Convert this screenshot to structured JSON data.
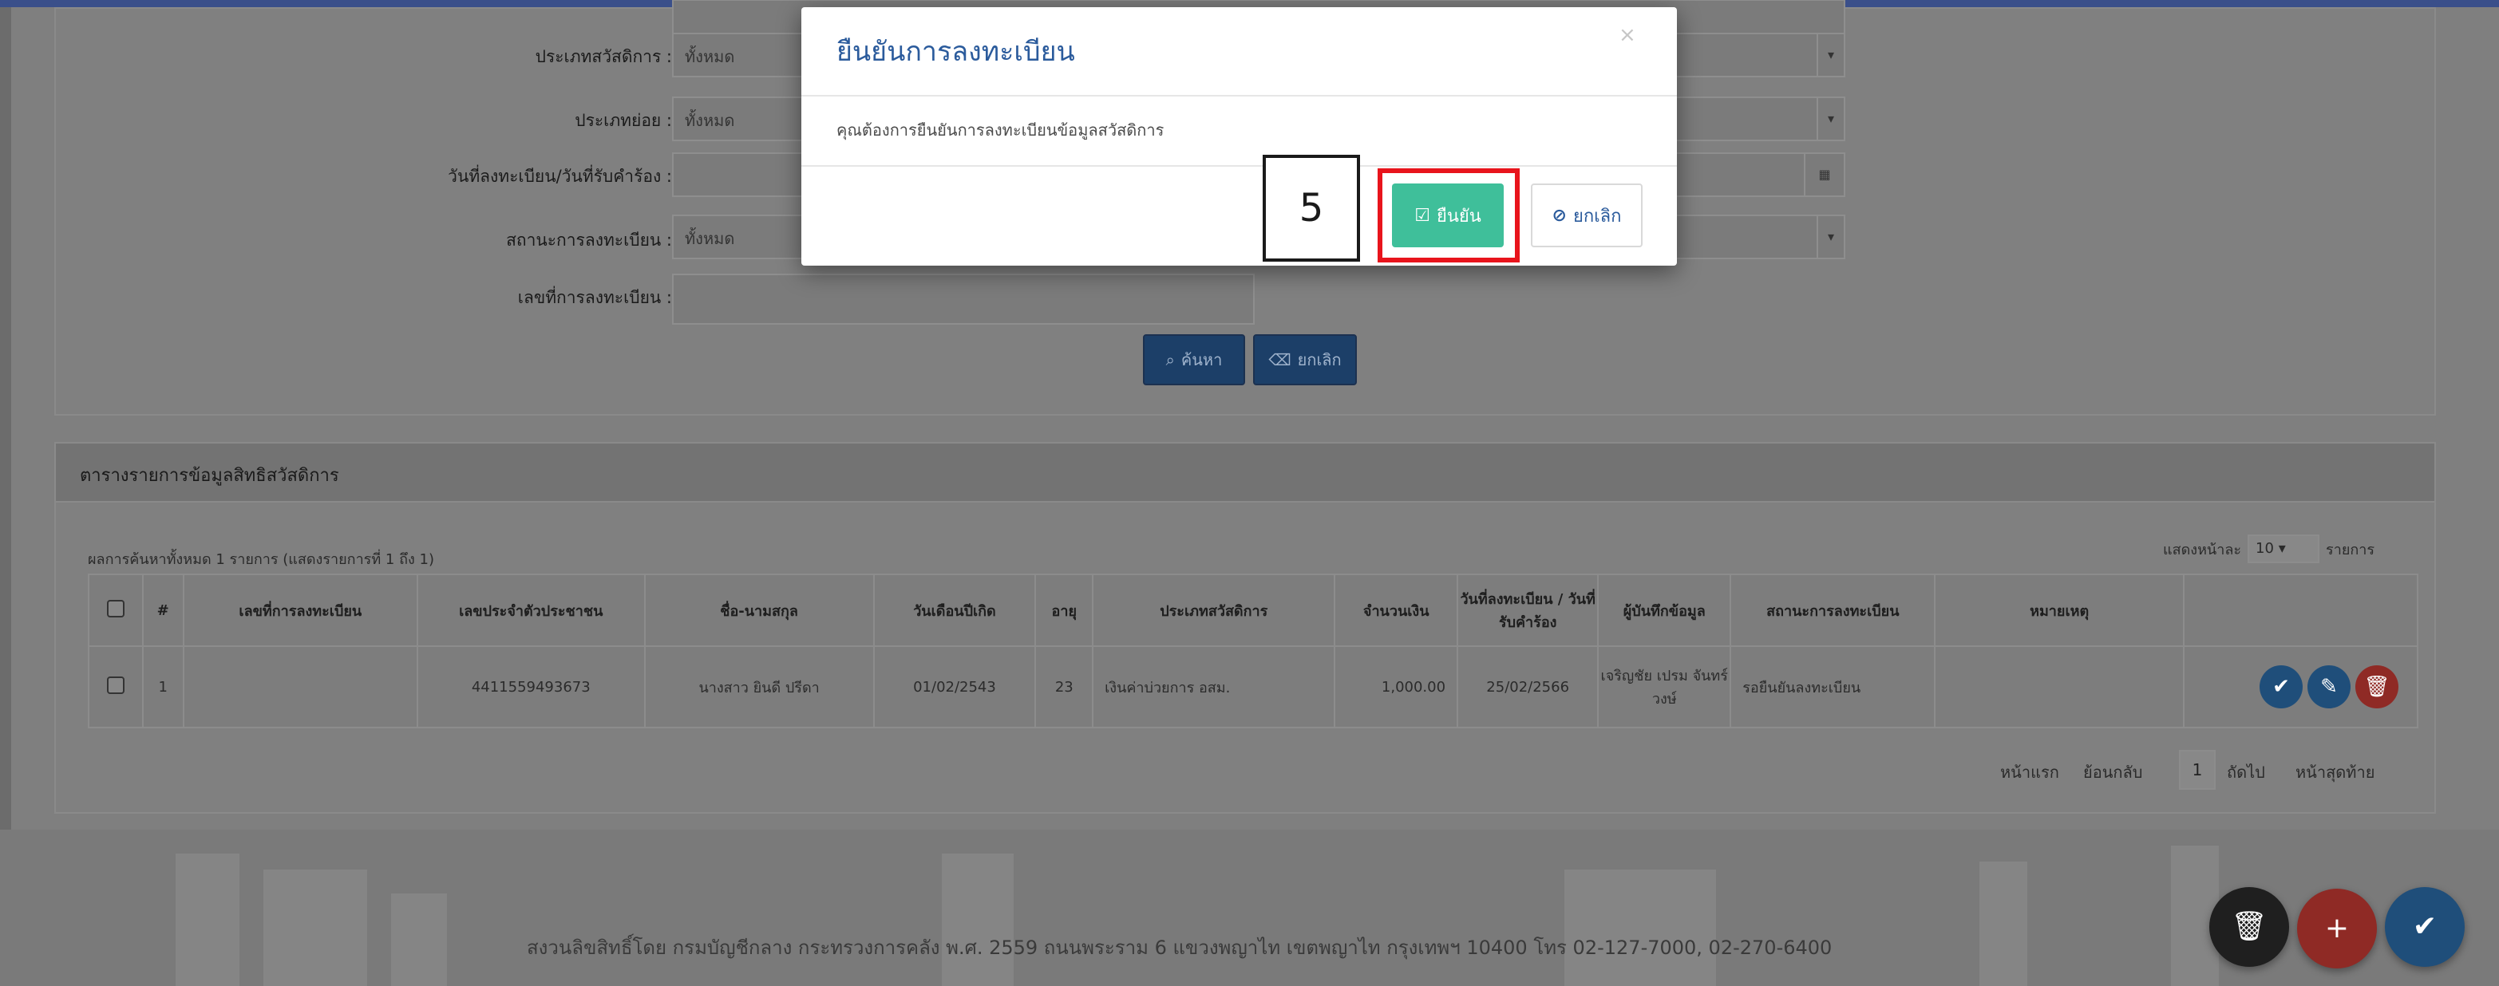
{
  "search_form": {
    "welfare_type_label": "ประเภทสวัสดิการ :",
    "welfare_type_value": "ทั้งหมด",
    "sub_type_label": "ประเภทย่อย :",
    "sub_type_value": "ทั้งหมด",
    "date_label": "วันที่ลงทะเบียน/วันที่รับคำร้อง :",
    "status_label": "สถานะการลงทะเบียน :",
    "status_value": "ทั้งหมด",
    "reg_no_label": "เลขที่การลงทะเบียน :",
    "search_button": "ค้นหา",
    "clear_button": "ยกเลิก"
  },
  "results": {
    "title": "ตารางรายการข้อมูลสิทธิสวัสดิการ",
    "summary": "ผลการค้นหาทั้งหมด 1 รายการ (แสดงรายการที่ 1 ถึง 1)",
    "page_size_prefix": "แสดงหน้าละ",
    "page_size_value": "10",
    "page_size_suffix": "รายการ",
    "columns": [
      "#",
      "เลขที่การลงทะเบียน",
      "เลขประจำตัวประชาชน",
      "ชื่อ-นามสกุล",
      "วันเดือนปีเกิด",
      "อายุ",
      "ประเภทสวัสดิการ",
      "จำนวนเงิน",
      "วันที่ลงทะเบียน / วันที่รับคำร้อง",
      "ผู้บันทึกข้อมูล",
      "สถานะการลงทะเบียน",
      "หมายเหตุ"
    ],
    "rows": [
      {
        "no": "1",
        "reg_no": "",
        "citizen_id": "4411559493673",
        "name": "นางสาว ยินดี ปรีดา",
        "dob": "01/02/2543",
        "age": "23",
        "welfare": "เงินค่าบ่วยการ อสม.",
        "amount": "1,000.00",
        "reg_date": "25/02/2566",
        "recorder": "เจริญชัย เปรม จันทร์วงษ์",
        "status": "รอยืนยันลงทะเบียน",
        "note": ""
      }
    ],
    "pagination": {
      "first": "หน้าแรก",
      "prev": "ย้อนกลับ",
      "current": "1",
      "next": "ถัดไป",
      "last": "หน้าสุดท้าย"
    }
  },
  "footer": {
    "text": "สงวนลิขสิทธิ์โดย กรมบัญชีกลาง กระทรวงการคลัง พ.ศ. 2559 ถนนพระราม 6 แขวงพญาไท เขตพญาไท กรุงเทพฯ 10400 โทร 02-127-7000, 02-270-6400"
  },
  "modal": {
    "title": "ยืนยันการลงทะเบียน",
    "close": "×",
    "body": "คุณต้องการยืนยันการลงทะเบียนข้อมูลสวัสดิการ",
    "confirm_button": "ยืนยัน",
    "cancel_button": "ยกเลิก",
    "step_marker": "5"
  },
  "colors": {
    "confirm": "#3fbf9a",
    "highlight": "#e8141c",
    "title": "#2b5b9c",
    "fab_delete": "#1f1f1f",
    "fab_add": "#8f2a25",
    "fab_confirm": "#1f4e7a"
  },
  "icons": [
    "chevron-down-icon",
    "calendar-icon",
    "search-icon",
    "eraser-icon",
    "check-icon",
    "edit-icon",
    "trash-icon",
    "plus-icon",
    "close-icon",
    "check-square-icon",
    "circle-x-icon"
  ]
}
